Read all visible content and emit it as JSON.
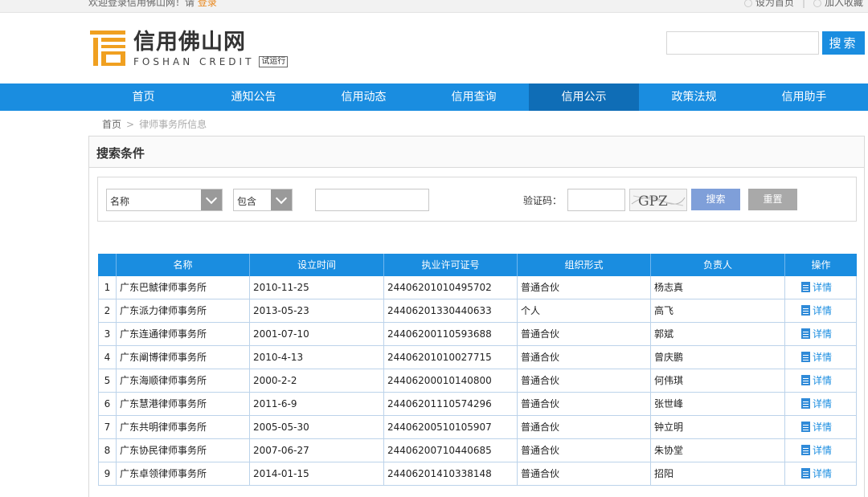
{
  "topbar": {
    "welcome": "欢迎登录信用佛山网！请",
    "login": "登录",
    "set_home": "设为首页",
    "sep": "|",
    "add_favorite": "加入收藏"
  },
  "header": {
    "logo_cn": "信用佛山网",
    "logo_en": "FOSHAN CREDIT",
    "trial_badge": "试运行",
    "search_placeholder": "",
    "search_button": "搜索"
  },
  "nav": {
    "items": [
      {
        "label": "首页",
        "active": false
      },
      {
        "label": "通知公告",
        "active": false
      },
      {
        "label": "信用动态",
        "active": false
      },
      {
        "label": "信用查询",
        "active": false
      },
      {
        "label": "信用公示",
        "active": true
      },
      {
        "label": "政策法规",
        "active": false
      },
      {
        "label": "信用助手",
        "active": false
      }
    ]
  },
  "breadcrumb": {
    "home": "首页",
    "separator": ">",
    "current": "律师事务所信息"
  },
  "search_panel": {
    "title": "搜索条件",
    "field_select": "名称",
    "match_select": "包含",
    "keyword_value": "",
    "captcha_label": "验证码：",
    "captcha_value": "",
    "captcha_text": "GPZ",
    "search_button": "搜索",
    "reset_button": "重置"
  },
  "table": {
    "headers": [
      "名称",
      "设立时间",
      "执业许可证号",
      "组织形式",
      "负责人",
      "操作"
    ],
    "detail_label": "详情",
    "rows": [
      {
        "idx": "1",
        "name": "广东巴虩律师事务所",
        "date": "2010-11-25",
        "license": "24406201010495702",
        "form": "普通合伙",
        "head": "杨志真"
      },
      {
        "idx": "2",
        "name": "广东派力律师事务所",
        "date": "2013-05-23",
        "license": "24406201330440633",
        "form": "个人",
        "head": "高飞"
      },
      {
        "idx": "3",
        "name": "广东连通律师事务所",
        "date": "2001-07-10",
        "license": "24406200110593688",
        "form": "普通合伙",
        "head": "郭斌"
      },
      {
        "idx": "4",
        "name": "广东阐博律师事务所",
        "date": "2010-4-13",
        "license": "24406201010027715",
        "form": "普通合伙",
        "head": "曾庆鹏"
      },
      {
        "idx": "5",
        "name": "广东海顺律师事务所",
        "date": "2000-2-2",
        "license": "24406200010140800",
        "form": "普通合伙",
        "head": "何伟琪"
      },
      {
        "idx": "6",
        "name": "广东慧港律师事务所",
        "date": "2011-6-9",
        "license": "24406201110574296",
        "form": "普通合伙",
        "head": "张世峰"
      },
      {
        "idx": "7",
        "name": "广东共明律师事务所",
        "date": "2005-05-30",
        "license": "24406200510105907",
        "form": "普通合伙",
        "head": "钟立明"
      },
      {
        "idx": "8",
        "name": "广东协民律师事务所",
        "date": "2007-06-27",
        "license": "24406200710440685",
        "form": "普通合伙",
        "head": "朱协堂"
      },
      {
        "idx": "9",
        "name": "广东卓领律师事务所",
        "date": "2014-01-15",
        "license": "24406201410338148",
        "form": "普通合伙",
        "head": "招阳"
      }
    ]
  },
  "colors": {
    "primary": "#1a8de0",
    "nav_active": "#0f6db6",
    "logo": "#f0a020",
    "login_link": "#e8861a"
  }
}
